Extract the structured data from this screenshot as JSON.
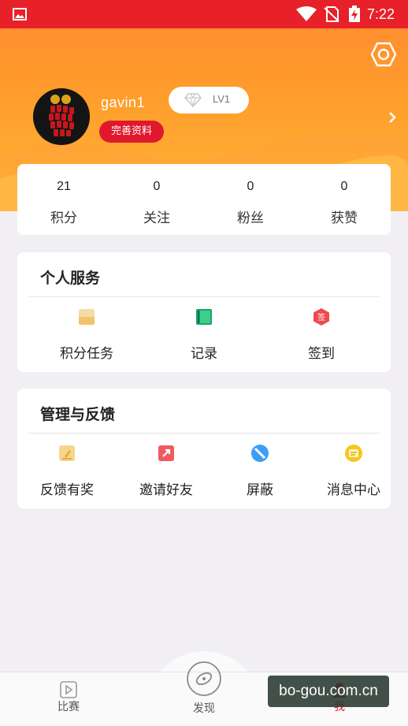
{
  "status_bar": {
    "time": "7:22",
    "icons": [
      "image-icon",
      "wifi-icon",
      "no-sim-icon",
      "battery-charging-icon"
    ]
  },
  "profile": {
    "username": "gavin1",
    "level": "LV1",
    "complete_profile_label": "完善资料",
    "icons": [
      "settings-icon",
      "diamond-icon",
      "chevron-right-icon"
    ]
  },
  "stats": [
    {
      "value": "21",
      "label": "积分"
    },
    {
      "value": "0",
      "label": "关注"
    },
    {
      "value": "0",
      "label": "粉丝"
    },
    {
      "value": "0",
      "label": "获赞"
    }
  ],
  "personal_services": {
    "title": "个人服务",
    "items": [
      {
        "label": "积分任务",
        "icon": "points-task-icon"
      },
      {
        "label": "记录",
        "icon": "record-book-icon"
      },
      {
        "label": "签到",
        "icon": "check-in-icon",
        "icon_text": "签"
      }
    ]
  },
  "management": {
    "title": "管理与反馈",
    "items": [
      {
        "label": "反馈有奖",
        "icon": "feedback-icon"
      },
      {
        "label": "邀请好友",
        "icon": "invite-icon"
      },
      {
        "label": "屏蔽",
        "icon": "block-icon"
      },
      {
        "label": "消息中心",
        "icon": "message-icon"
      }
    ]
  },
  "bottom_nav": {
    "items": [
      {
        "label": "比赛",
        "icon": "match-play-icon"
      },
      {
        "label": "发现",
        "icon": "discover-icon"
      },
      {
        "label": "我",
        "icon": "me-icon",
        "active": true
      }
    ]
  },
  "watermark": "bo-gou.com.cn",
  "colors": {
    "status_bar": "#e8202a",
    "header_gradient_top": "#ff8f2f",
    "header_gradient_bottom": "#ffb638",
    "accent_red": "#e0182d",
    "page_background": "#f1eff4"
  }
}
